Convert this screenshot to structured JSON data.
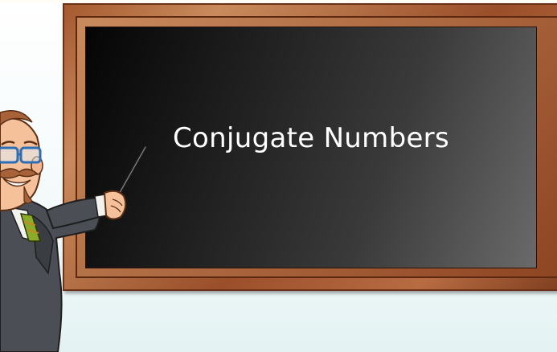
{
  "board": {
    "title": "Conjugate Numbers"
  },
  "illustration": {
    "character": "teacher-with-pointer",
    "colors": {
      "chalkboard": "#2b2b2b",
      "frame": "#a5592f",
      "background": "#e4f2f3"
    }
  }
}
